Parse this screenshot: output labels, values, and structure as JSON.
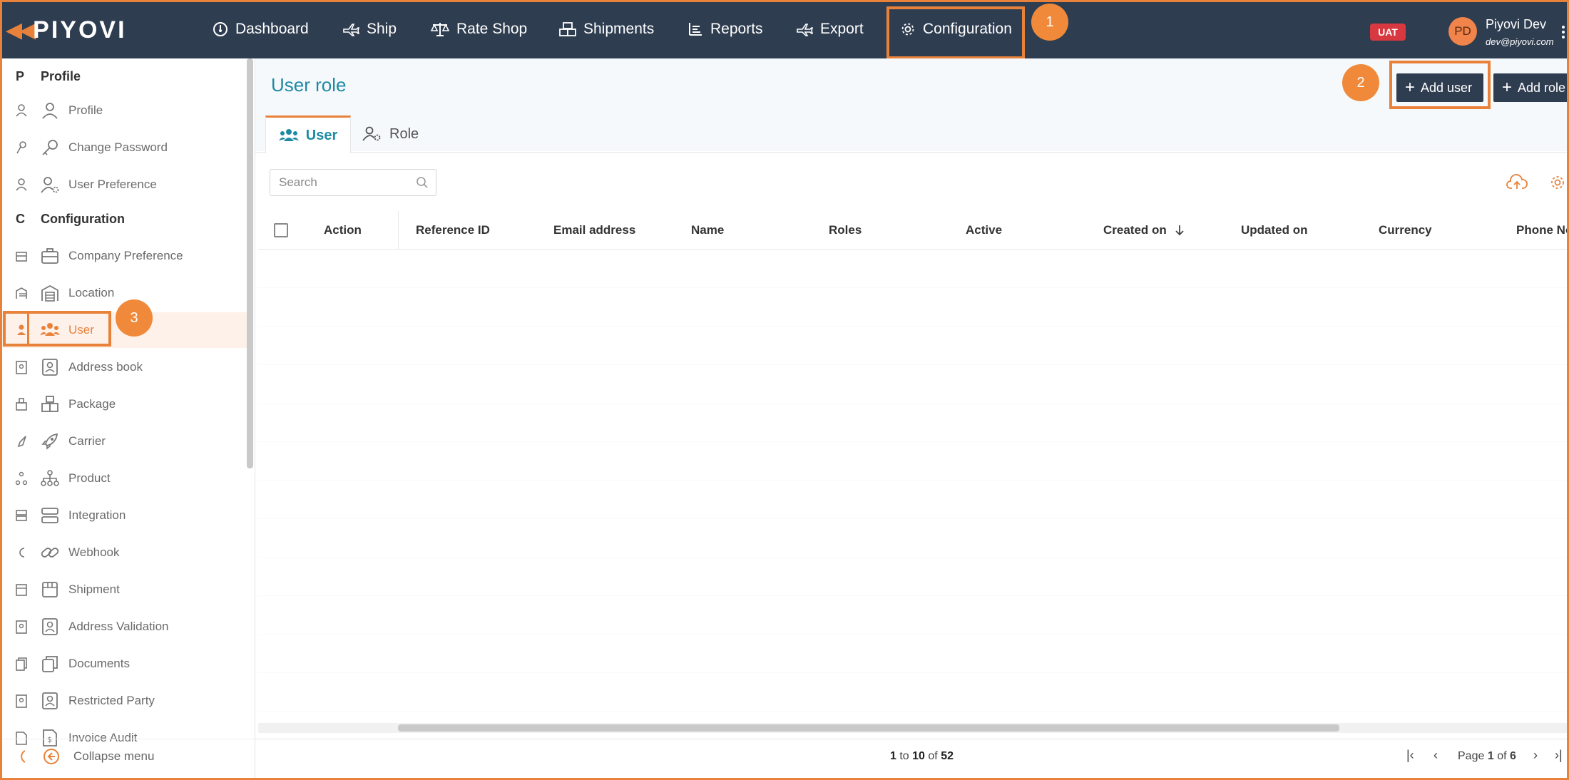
{
  "brand": {
    "logo_text": "PIYOVI",
    "accent": "#e8823a",
    "nav_bg": "#2f3d50",
    "link_color": "#1f8aa3"
  },
  "topnav": {
    "items": [
      {
        "label": "Dashboard",
        "icon": "dashboard-icon"
      },
      {
        "label": "Ship",
        "icon": "plane-icon"
      },
      {
        "label": "Rate Shop",
        "icon": "scale-icon"
      },
      {
        "label": "Shipments",
        "icon": "boxes-icon"
      },
      {
        "label": "Reports",
        "icon": "report-icon"
      },
      {
        "label": "Export",
        "icon": "plane-export-icon"
      },
      {
        "label": "Configuration",
        "icon": "gear-icon"
      }
    ],
    "env_badge": "UAT",
    "user": {
      "initials": "PD",
      "name": "Piyovi Dev",
      "email": "dev@piyovi.com"
    }
  },
  "callouts": [
    "1",
    "2",
    "3"
  ],
  "sidebar": {
    "sections": [
      {
        "title": "Profile",
        "abbrev": "P"
      },
      {
        "title": "Configuration",
        "abbrev": "C"
      }
    ],
    "profile_items": [
      "Profile",
      "Change Password",
      "User Preference"
    ],
    "config_items": [
      "Company Preference",
      "Location",
      "User",
      "Address book",
      "Package",
      "Carrier",
      "Product",
      "Integration",
      "Webhook",
      "Shipment",
      "Address Validation",
      "Documents",
      "Restricted Party",
      "Invoice Audit"
    ],
    "active_item": "User",
    "collapse_label": "Collapse menu"
  },
  "page": {
    "title": "User role",
    "add_user": "Add user",
    "add_role": "Add role",
    "tabs": [
      "User",
      "Role"
    ],
    "search_placeholder": "Search"
  },
  "table": {
    "columns": [
      "Action",
      "Reference ID",
      "Email address",
      "Name",
      "Roles",
      "Active",
      "Created on",
      "Updated on",
      "Currency",
      "Phone No"
    ],
    "sort_column": "Created on",
    "sort_dir": "desc",
    "rows": []
  },
  "pagination": {
    "from": "1",
    "to_word": "to",
    "to": "10",
    "of_word": "of",
    "total": "52",
    "page_word": "Page",
    "page": "1",
    "page_of_word": "of",
    "pages": "6"
  }
}
